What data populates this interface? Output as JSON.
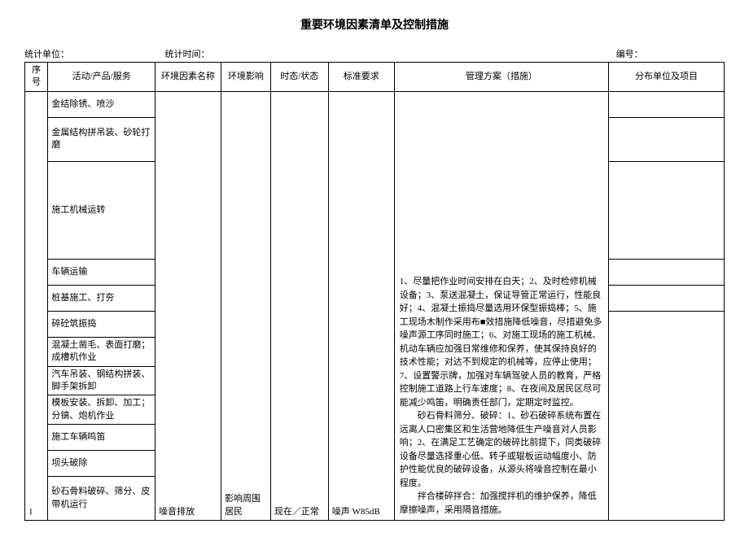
{
  "title": "重要环境因素清单及控制措施",
  "meta": {
    "unit_label": "统计单位：",
    "time_label": "统计时间：",
    "code_label": "编号："
  },
  "headers": {
    "xuhao": "序号",
    "activity": "活动/产品/服务",
    "factor": "环境因素名称",
    "impact": "环境影响",
    "state": "时态/状态",
    "standard": "标准要求",
    "plan": "管理方案（措施）",
    "dist": "分布单位及项目"
  },
  "rows": {
    "r1": "金结除锈、喷沙",
    "r2": "金属结构拼吊装、砂轮打磨",
    "r3": "施工机械运转",
    "r4": "车辆运输",
    "r5": "桩基施工、打夯",
    "r6": "碎砼筑振捣",
    "r7": "混凝土凿毛、表面打磨；成槽机作业",
    "r8": "汽车吊装、钢结构拼装、脚手架拆卸",
    "r9": "模板安装、拆卸、加工；分镐、炮机作业",
    "r10": "施工车辆鸣笛",
    "r11": "坝头破除",
    "r12": "砂石骨料破碎、筛分、皮带机运行"
  },
  "seq": "1",
  "factor_val": "噪音排放",
  "impact_val": "影响周围居民",
  "state_val": "现在／正常",
  "standard_val": "噪声 W85dB",
  "plan_text": {
    "p1": "1、尽量把作业时间安排在白天；2、及时检修机械设备；3、泵送混凝土，保证导管正常运行，性能良好；4、混凝土振捣尽量选用环保型振捣棒；5、施工现场木制作采用布■效措施降低噪音，尽措避免多噪声源工序同时施工；6、对施工现场的施工机械、机动车辆应加强日常维修和保养，使其保持良好的技术性能；对达不到规定的机械等，应停止使用；7、设置警示牌，加强对车辆驾驶人员的教育，严格控制施工道路上行车速度；8、在夜间及居民区尽可能减少鸣笛，明确责任部门，定期定时监控。",
    "p2": "砂石骨料筛分、破碎：1、砂石破碎系统布置在远离人口密集区和生活营地降低生产噪音对人员影响；2、在满足工艺确定的破碎比前提下，同类破碎设备尽量选择重心低、转子或辊板运动幅度小、防护性能优良的破碎设备，从源头将噪音控制在最小程度。",
    "p3": "拌合楼碎拌合：加强搅拌机的维护保养，降低摩擦噪声，采用隔音措施。"
  }
}
